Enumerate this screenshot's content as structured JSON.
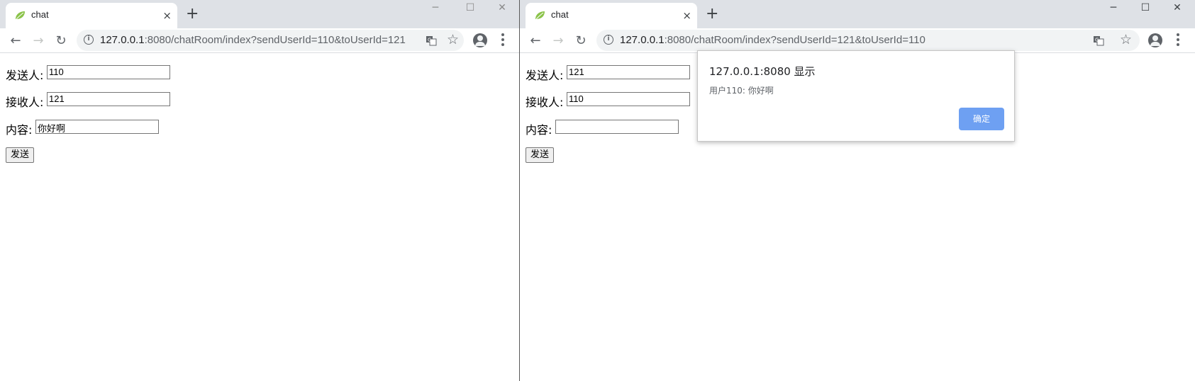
{
  "colors": {
    "titlebar": "#dee1e6",
    "omnibox": "#f1f3f4",
    "dialog_button": "#6ea0f2",
    "window_separator": "#5a5a5a"
  },
  "left_window": {
    "tab": {
      "title": "chat",
      "favicon": "spring-leaf-icon",
      "close": "×"
    },
    "new_tab": "+",
    "controls": {
      "minimize": "─",
      "maximize": "☐",
      "close": "✕"
    },
    "url": {
      "host": "127.0.0.1",
      "rest": ":8080/chatRoom/index?sendUserId=110&toUserId=121"
    },
    "form": {
      "sender_label": "发送人:",
      "sender_value": "110",
      "receiver_label": "接收人:",
      "receiver_value": "121",
      "content_label": "内容:",
      "content_value": "你好啊",
      "send_button": "发送"
    }
  },
  "right_window": {
    "tab": {
      "title": "chat",
      "favicon": "spring-leaf-icon",
      "close": "×"
    },
    "new_tab": "+",
    "controls": {
      "minimize": "─",
      "maximize": "☐",
      "close": "✕"
    },
    "url": {
      "host": "127.0.0.1",
      "rest": ":8080/chatRoom/index?sendUserId=121&toUserId=110"
    },
    "form": {
      "sender_label": "发送人:",
      "sender_value": "121",
      "receiver_label": "接收人:",
      "receiver_value": "110",
      "content_label": "内容:",
      "content_value": "",
      "send_button": "发送"
    },
    "alert": {
      "title": "127.0.0.1:8080 显示",
      "message": "用户110: 你好啊",
      "ok_button": "确定"
    }
  }
}
